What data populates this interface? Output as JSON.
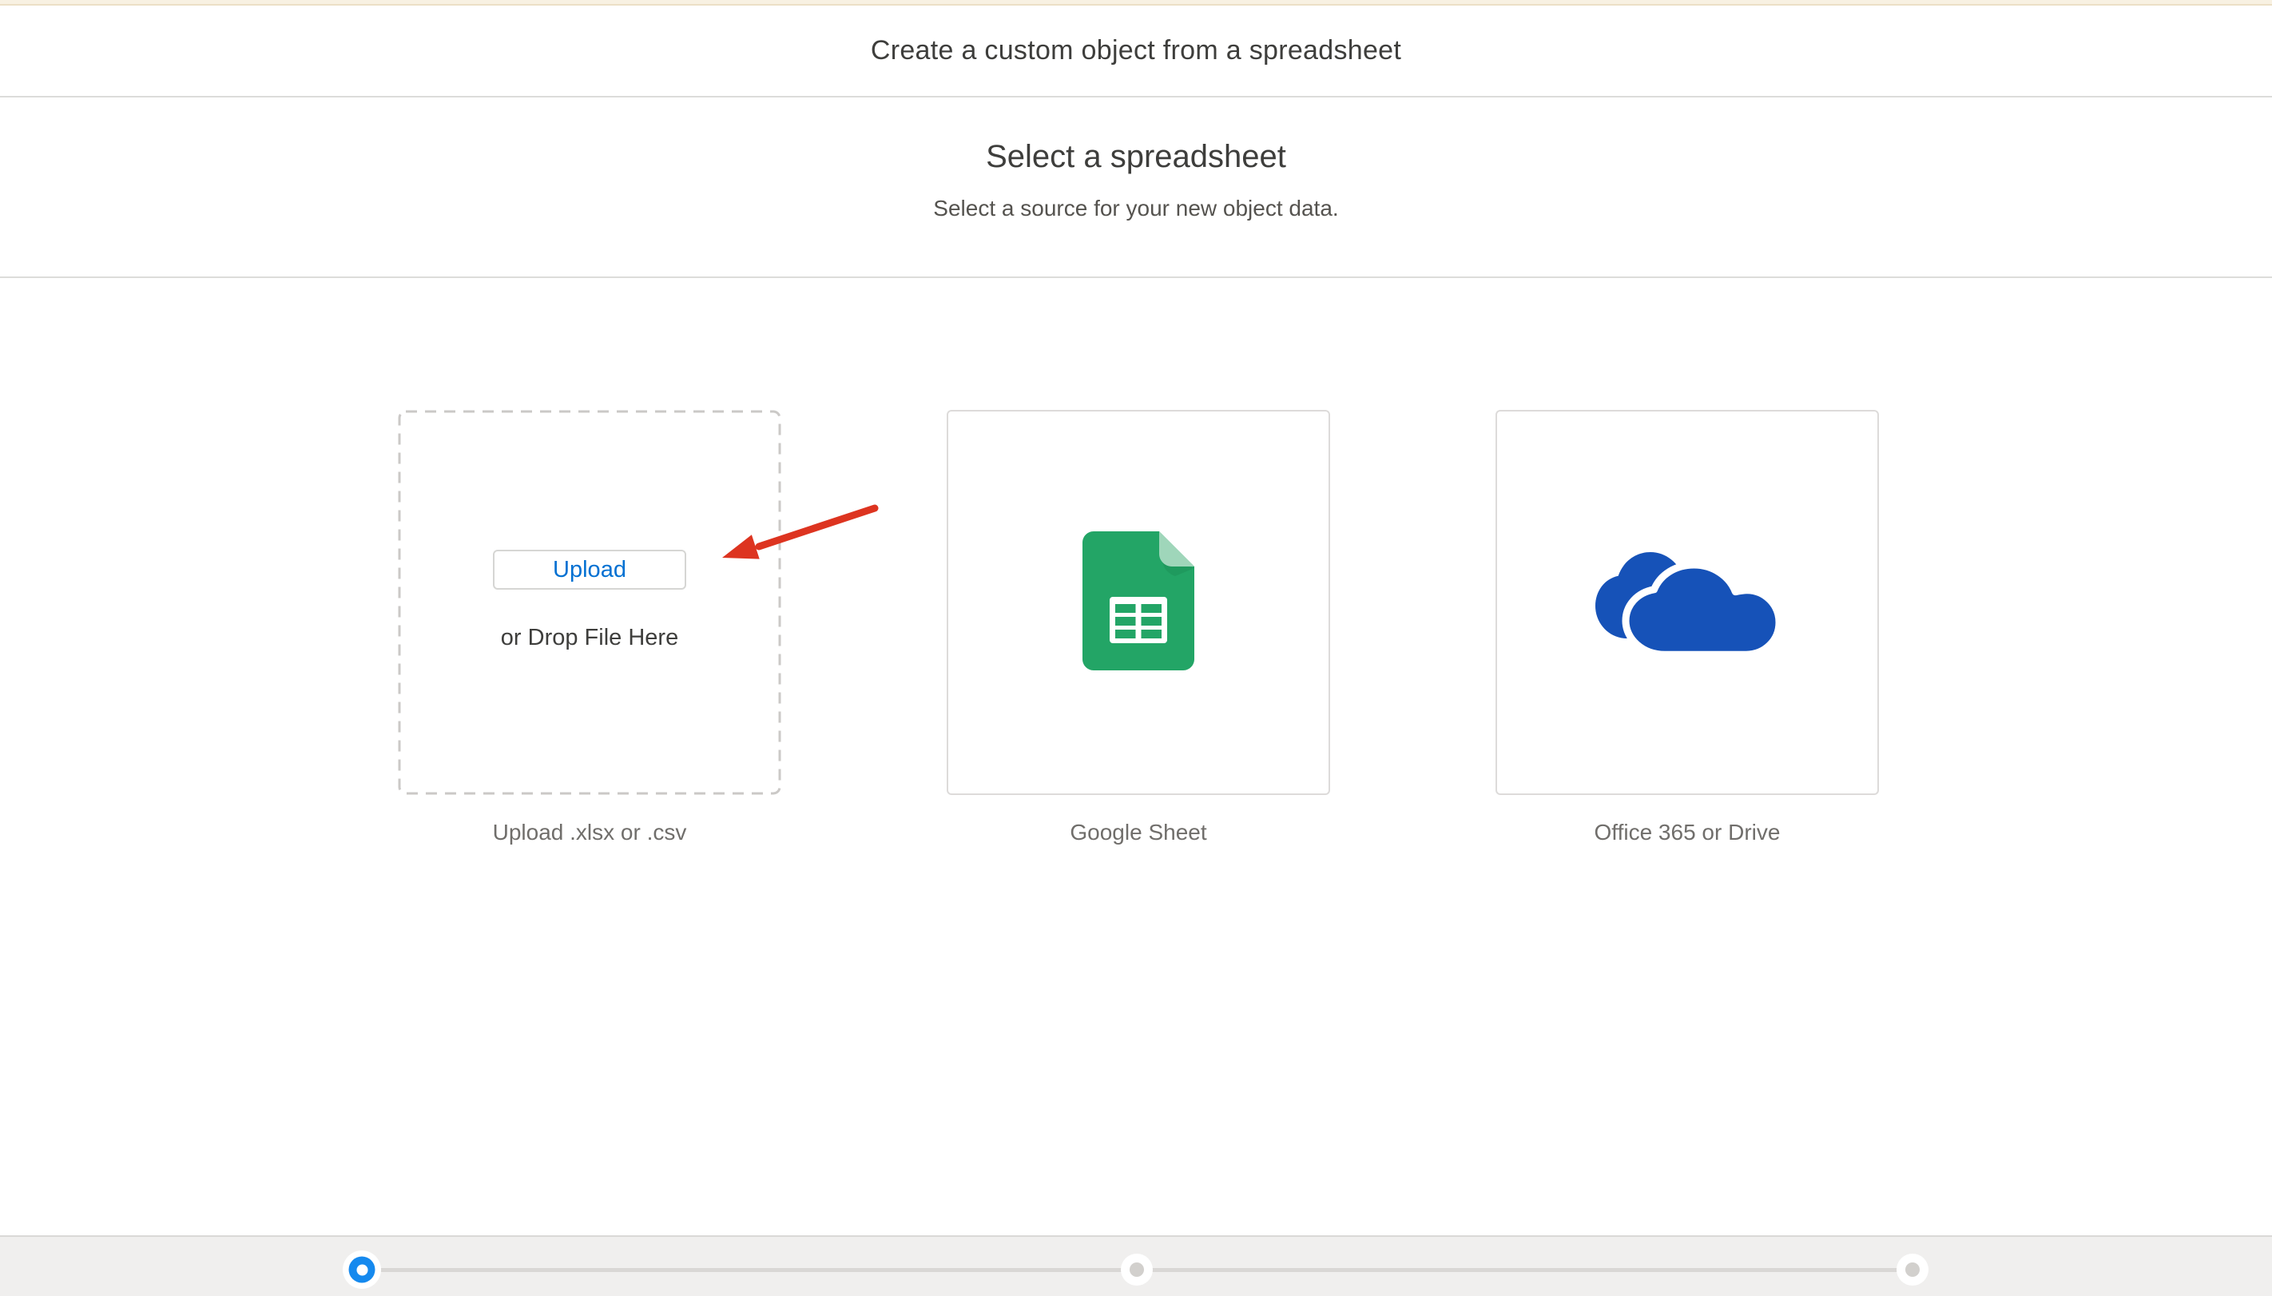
{
  "header": {
    "title": "Create a custom object from a spreadsheet"
  },
  "intro": {
    "heading": "Select a spreadsheet",
    "subheading": "Select a source for your new object data."
  },
  "sources": {
    "upload": {
      "button_label": "Upload",
      "drop_hint": "or Drop File Here",
      "caption": "Upload .xlsx or .csv"
    },
    "google_sheet": {
      "caption": "Google Sheet"
    },
    "office": {
      "caption": "Office 365 or Drive"
    }
  },
  "icons": {
    "google_sheet": "google-sheets-icon",
    "office": "onedrive-clouds-icon",
    "annotation": "red-arrow-icon"
  },
  "progress": {
    "steps": 3,
    "current_step": 1
  },
  "colors": {
    "accent_blue": "#0070d2",
    "progress_active_blue": "#1589ee",
    "arrow_red": "#dd3420",
    "google_green": "#23a566",
    "google_green_light": "#9fd6ba",
    "onedrive_blue": "#1652b8",
    "top_strip_cream": "#f8f1e2",
    "caption_gray": "#706e6b",
    "border_gray": "#dcdcda"
  }
}
